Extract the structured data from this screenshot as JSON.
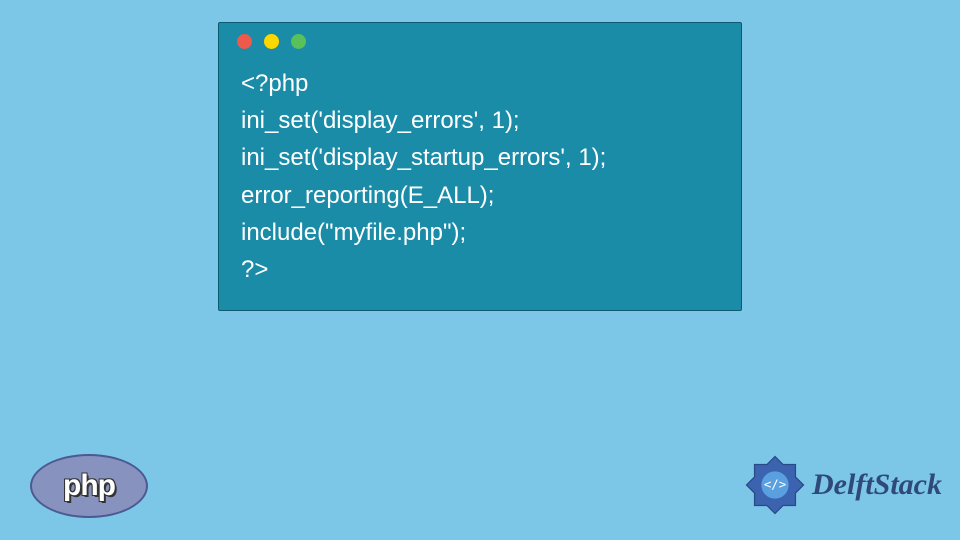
{
  "code": {
    "lines": [
      "<?php",
      "ini_set('display_errors', 1);",
      "ini_set('display_startup_errors', 1);",
      "error_reporting(E_ALL);",
      "include(\"myfile.php\");",
      "?>"
    ]
  },
  "php_badge": {
    "label": "php"
  },
  "brand": {
    "name": "DelftStack"
  },
  "window_controls": {
    "close": "close",
    "minimize": "minimize",
    "zoom": "zoom"
  }
}
